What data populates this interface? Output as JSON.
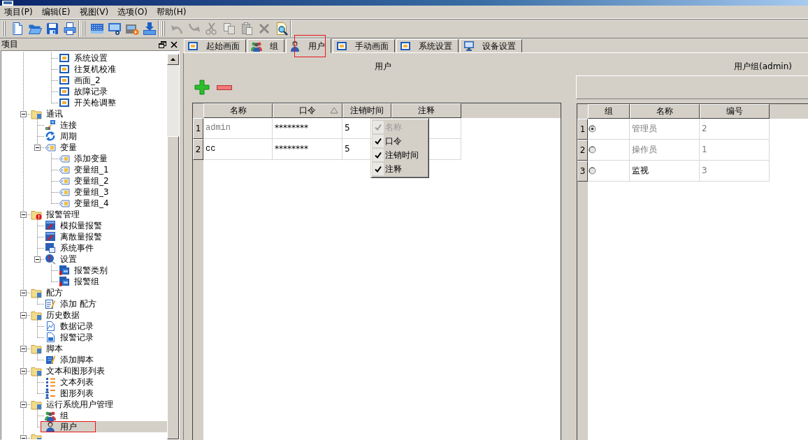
{
  "menu_bar": {
    "items": [
      "项目(P)",
      "编辑(E)",
      "视图(V)",
      "选项(O)",
      "帮助(H)"
    ]
  },
  "toolbar": {
    "groups": [
      [
        {
          "kind": "new",
          "disabled": false
        },
        {
          "kind": "open",
          "disabled": false
        },
        {
          "kind": "save",
          "disabled": false
        },
        {
          "kind": "print",
          "disabled": false
        }
      ],
      [
        {
          "kind": "grid",
          "disabled": false
        },
        {
          "kind": "monitor",
          "disabled": false
        },
        {
          "kind": "device",
          "disabled": false
        },
        {
          "kind": "download",
          "disabled": false
        }
      ],
      [
        {
          "kind": "undo",
          "disabled": true
        },
        {
          "kind": "redo",
          "disabled": true
        },
        {
          "kind": "cut",
          "disabled": true
        },
        {
          "kind": "copy",
          "disabled": true
        },
        {
          "kind": "paste",
          "disabled": true
        },
        {
          "kind": "delete",
          "disabled": true
        },
        {
          "kind": "preview",
          "disabled": false
        }
      ]
    ]
  },
  "project_panel": {
    "title": "项目",
    "tree": [
      {
        "kind": "offscreen",
        "children": [
          {
            "kind": "offscreen",
            "children": [
              {
                "label": "系统设置",
                "kind": "screen",
                "selected": false,
                "marked": false
              },
              {
                "label": "往复机校准",
                "kind": "screen",
                "selected": false,
                "marked": false
              },
              {
                "label": "画面_2",
                "kind": "screen",
                "selected": false,
                "marked": false
              },
              {
                "label": "故障记录",
                "kind": "screen",
                "selected": false,
                "marked": false
              },
              {
                "label": "开关枪调整",
                "kind": "screen",
                "selected": false,
                "marked": false
              }
            ]
          }
        ]
      },
      {
        "label": "通讯",
        "kind": "folder",
        "expanded": true,
        "selected": false,
        "marked": false,
        "children": [
          {
            "label": "连接",
            "kind": "link",
            "selected": false,
            "marked": false
          },
          {
            "label": "周期",
            "kind": "cycle",
            "selected": false,
            "marked": false
          },
          {
            "label": "变量",
            "kind": "tag",
            "expanded": true,
            "selected": false,
            "marked": false,
            "children": [
              {
                "label": "添加变量",
                "kind": "tag",
                "selected": false,
                "marked": false
              },
              {
                "label": "变量组_1",
                "kind": "tag",
                "selected": false,
                "marked": false
              },
              {
                "label": "变量组_2",
                "kind": "tag",
                "selected": false,
                "marked": false
              },
              {
                "label": "变量组_3",
                "kind": "tag",
                "selected": false,
                "marked": false
              },
              {
                "label": "变量组_4",
                "kind": "tag",
                "selected": false,
                "marked": false
              }
            ]
          }
        ]
      },
      {
        "label": "报警管理",
        "kind": "alertfolder",
        "expanded": true,
        "selected": false,
        "marked": false,
        "children": [
          {
            "label": "模拟量报警",
            "kind": "alarm",
            "selected": false,
            "marked": false
          },
          {
            "label": "离散量报警",
            "kind": "alarm",
            "selected": false,
            "marked": false
          },
          {
            "label": "系统事件",
            "kind": "event",
            "selected": false,
            "marked": false
          },
          {
            "label": "设置",
            "kind": "settings",
            "expanded": true,
            "selected": false,
            "marked": false,
            "children": [
              {
                "label": "报警类别",
                "kind": "alarmlist",
                "selected": false,
                "marked": false
              },
              {
                "label": "报警组",
                "kind": "alarmlist",
                "selected": false,
                "marked": false
              }
            ]
          }
        ]
      },
      {
        "label": "配方",
        "kind": "folder",
        "expanded": true,
        "selected": false,
        "marked": false,
        "children": [
          {
            "label": "添加 配方",
            "kind": "recipe",
            "selected": false,
            "marked": false
          }
        ]
      },
      {
        "label": "历史数据",
        "kind": "folder",
        "expanded": true,
        "selected": false,
        "marked": false,
        "children": [
          {
            "label": "数据记录",
            "kind": "chart",
            "selected": false,
            "marked": false
          },
          {
            "label": "报警记录",
            "kind": "log",
            "selected": false,
            "marked": false
          }
        ]
      },
      {
        "label": "脚本",
        "kind": "folder",
        "expanded": true,
        "selected": false,
        "marked": false,
        "children": [
          {
            "label": "添加脚本",
            "kind": "script",
            "selected": false,
            "marked": false
          }
        ]
      },
      {
        "label": "文本和图形列表",
        "kind": "folder",
        "expanded": true,
        "selected": false,
        "marked": false,
        "children": [
          {
            "label": "文本列表",
            "kind": "textlist",
            "selected": false,
            "marked": false
          },
          {
            "label": "图形列表",
            "kind": "imagelist",
            "selected": false,
            "marked": false
          }
        ]
      },
      {
        "label": "运行系统用户管理",
        "kind": "folder",
        "expanded": true,
        "selected": false,
        "marked": false,
        "children": [
          {
            "label": "组",
            "kind": "group",
            "selected": false,
            "marked": false
          },
          {
            "label": "用户",
            "kind": "user",
            "selected": true,
            "marked": true
          }
        ]
      },
      {
        "kind": "folder",
        "expanded": true,
        "selected": false,
        "marked": false
      }
    ]
  },
  "tabs": [
    {
      "label": "起始画面",
      "kind": "screen",
      "selected": false,
      "marked": false
    },
    {
      "label": "组",
      "kind": "group",
      "selected": false,
      "marked": false
    },
    {
      "label": "用户",
      "kind": "user",
      "selected": true,
      "marked": true
    },
    {
      "label": "手动画面",
      "kind": "screen",
      "selected": false,
      "marked": false
    },
    {
      "label": "系统设置",
      "kind": "screen",
      "selected": false,
      "marked": false
    },
    {
      "label": "设备设置",
      "kind": "device",
      "selected": false,
      "marked": false
    }
  ],
  "user_pane": {
    "title": "用户",
    "buttons": [
      {
        "kind": "add"
      },
      {
        "kind": "remove"
      }
    ],
    "table": {
      "columns": [
        {
          "label": "名称",
          "sorted": false
        },
        {
          "label": "口令",
          "sorted": true
        },
        {
          "label": "注销时间",
          "sorted": false
        },
        {
          "label": "注释",
          "sorted": false
        }
      ],
      "rows": [
        {
          "number": "1",
          "greyed": true,
          "cells": [
            "admin",
            "********",
            "5"
          ]
        },
        {
          "number": "2",
          "greyed": false,
          "cells": [
            "cc",
            "********",
            "5"
          ]
        }
      ]
    },
    "column_menu": {
      "items": [
        {
          "label": "名称",
          "checked": true,
          "disabled": true
        },
        {
          "label": "口令",
          "checked": true,
          "disabled": false
        },
        {
          "label": "注销时间",
          "checked": true,
          "disabled": false
        },
        {
          "label": "注释",
          "checked": true,
          "disabled": false
        }
      ]
    }
  },
  "group_pane": {
    "title": "用户组(admin)",
    "table": {
      "columns": [
        {
          "label": "组",
          "sorted": false
        },
        {
          "label": "名称",
          "sorted": false
        },
        {
          "label": "编号",
          "sorted": false
        }
      ],
      "rows": [
        {
          "number": "1",
          "selected": true,
          "greyed": true,
          "cells": [
            "管理员",
            "2"
          ]
        },
        {
          "number": "2",
          "selected": false,
          "greyed": true,
          "cells": [
            "操作员",
            "1"
          ]
        },
        {
          "number": "3",
          "selected": false,
          "greyed": false,
          "cells": [
            "监视",
            "3"
          ]
        }
      ]
    }
  }
}
